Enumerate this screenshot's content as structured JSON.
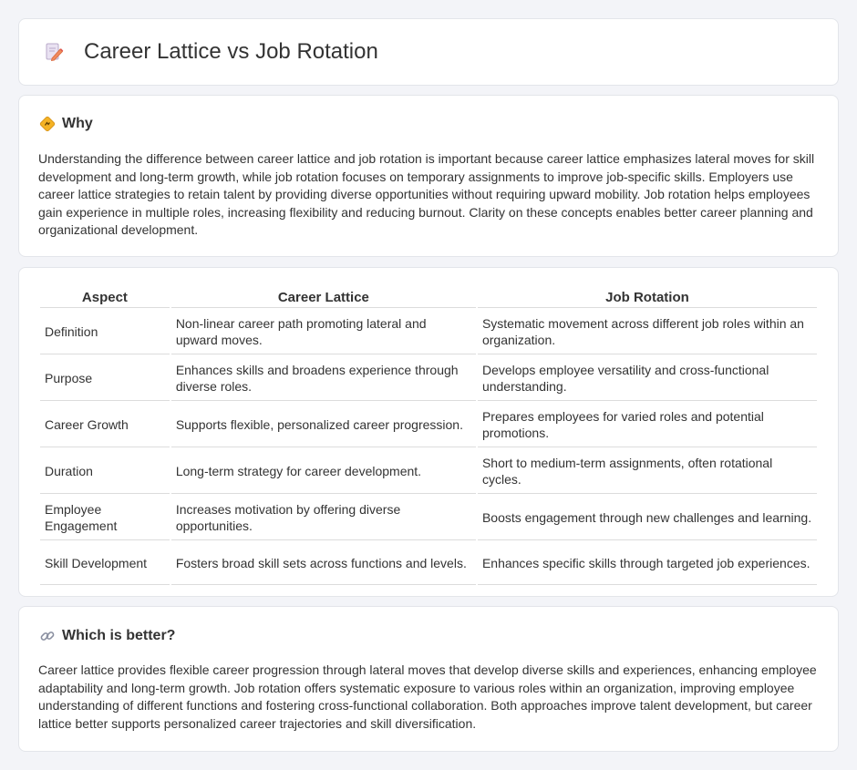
{
  "header": {
    "title": "Career Lattice vs Job Rotation",
    "icon": "document-pencil-icon"
  },
  "why": {
    "title": "Why",
    "icon": "diamond-sign-icon",
    "body": "Understanding the difference between career lattice and job rotation is important because career lattice emphasizes lateral moves for skill development and long-term growth, while job rotation focuses on temporary assignments to improve job-specific skills. Employers use career lattice strategies to retain talent by providing diverse opportunities without requiring upward mobility. Job rotation helps employees gain experience in multiple roles, increasing flexibility and reducing burnout. Clarity on these concepts enables better career planning and organizational development."
  },
  "table": {
    "headers": [
      "Aspect",
      "Career Lattice",
      "Job Rotation"
    ],
    "rows": [
      [
        "Definition",
        "Non-linear career path promoting lateral and upward moves.",
        "Systematic movement across different job roles within an organization."
      ],
      [
        "Purpose",
        "Enhances skills and broadens experience through diverse roles.",
        "Develops employee versatility and cross-functional understanding."
      ],
      [
        "Career Growth",
        "Supports flexible, personalized career progression.",
        "Prepares employees for varied roles and potential promotions."
      ],
      [
        "Duration",
        "Long-term strategy for career development.",
        "Short to medium-term assignments, often rotational cycles."
      ],
      [
        "Employee Engagement",
        "Increases motivation by offering diverse opportunities.",
        "Boosts engagement through new challenges and learning."
      ],
      [
        "Skill Development",
        "Fosters broad skill sets across functions and levels.",
        "Enhances specific skills through targeted job experiences."
      ]
    ]
  },
  "better": {
    "title": "Which is better?",
    "icon": "link-icon",
    "body": "Career lattice provides flexible career progression through lateral moves that develop diverse skills and experiences, enhancing employee adaptability and long-term growth. Job rotation offers systematic exposure to various roles within an organization, improving employee understanding of different functions and fostering cross-functional collaboration. Both approaches improve talent development, but career lattice better supports personalized career trajectories and skill diversification."
  }
}
